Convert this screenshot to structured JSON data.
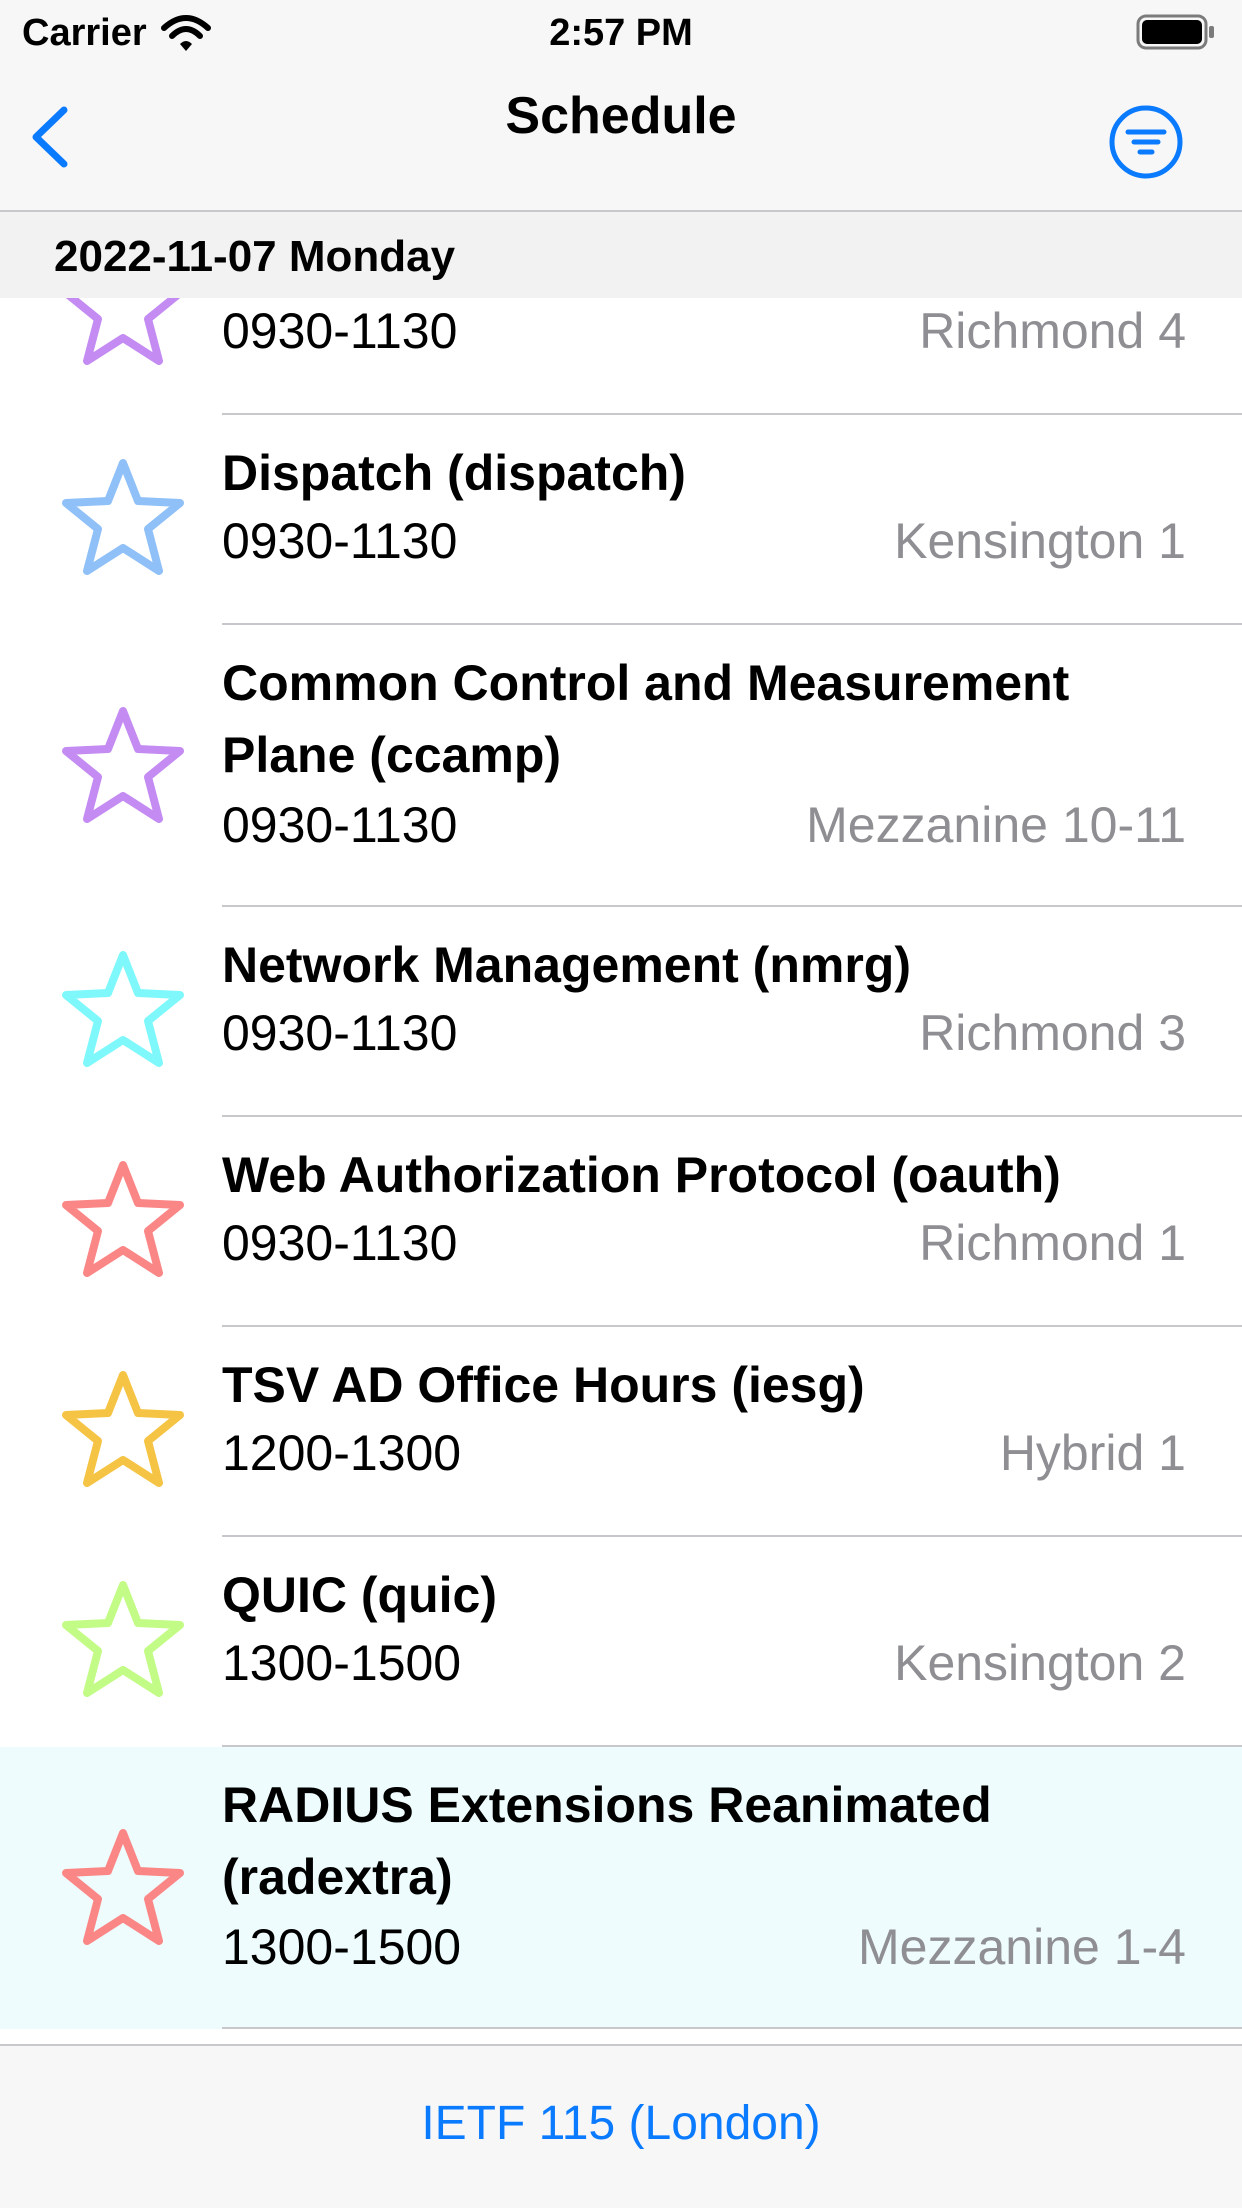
{
  "status_bar": {
    "carrier": "Carrier",
    "time": "2:57 PM",
    "icons": [
      "wifi-icon",
      "battery-icon"
    ]
  },
  "nav": {
    "title": "Schedule",
    "back_icon": "chevron-left-icon",
    "filter_icon": "filter-list-icon",
    "accent_color": "#0a7aff"
  },
  "section": {
    "date_label": "2022-11-07 Monday"
  },
  "sessions": [
    {
      "title": "",
      "time": "0930-1130",
      "room": "Richmond 4",
      "star_color": "#c48cf2",
      "selected": false
    },
    {
      "title": "Dispatch (dispatch)",
      "time": "0930-1130",
      "room": "Kensington 1",
      "star_color": "#8fc0f8",
      "selected": false
    },
    {
      "title": "Common Control and Measurement Plane (ccamp)",
      "time": "0930-1130",
      "room": "Mezzanine 10-11",
      "star_color": "#c48cf2",
      "selected": false
    },
    {
      "title": "Network Management (nmrg)",
      "time": "0930-1130",
      "room": "Richmond 3",
      "star_color": "#7ff8fb",
      "selected": false
    },
    {
      "title": "Web Authorization Protocol (oauth)",
      "time": "0930-1130",
      "room": "Richmond 1",
      "star_color": "#fb8686",
      "selected": false
    },
    {
      "title": "TSV AD Office Hours (iesg)",
      "time": "1200-1300",
      "room": "Hybrid 1",
      "star_color": "#f6c444",
      "selected": false
    },
    {
      "title": "QUIC (quic)",
      "time": "1300-1500",
      "room": "Kensington 2",
      "star_color": "#c2fb85",
      "selected": false
    },
    {
      "title": "RADIUS Extensions Reanimated (radextra)",
      "time": "1300-1500",
      "room": "Mezzanine 1-4",
      "star_color": "#fb8686",
      "selected": true
    }
  ],
  "toolbar": {
    "meeting_label": "IETF 115 (London)"
  }
}
